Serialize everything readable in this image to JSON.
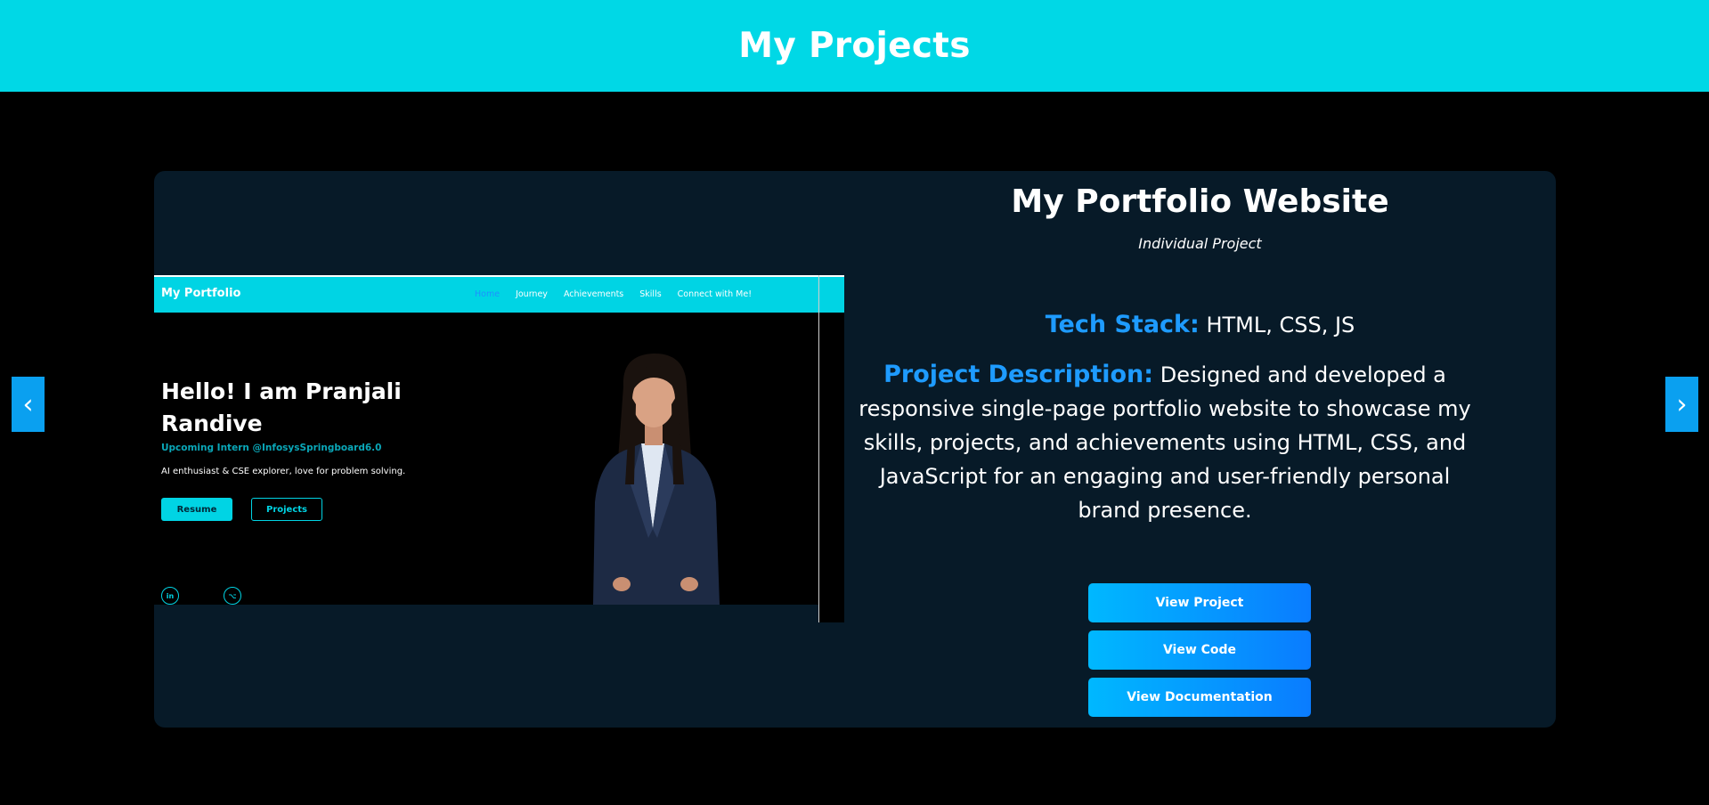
{
  "header": {
    "title": "My Projects"
  },
  "carousel": {
    "prev_glyph": "‹",
    "next_glyph": "›"
  },
  "project": {
    "title": "My Portfolio Website",
    "subtitle": "Individual Project",
    "tech_label": "Tech Stack:",
    "tech_value": "HTML, CSS, JS",
    "desc_label": "Project Description:",
    "desc_value": "Designed and developed a responsive single-page portfolio website to showcase my skills, projects, and achievements using HTML, CSS, and JavaScript for an engaging and user-friendly personal brand presence.",
    "buttons": {
      "view_project": "View Project",
      "view_code": "View Code",
      "view_docs": "View Documentation"
    }
  },
  "preview": {
    "brand": "My Portfolio",
    "nav": [
      "Home",
      "Journey",
      "Achievements",
      "Skills",
      "Connect with Me!"
    ],
    "hello": "Hello! I am Pranjali Randive",
    "intern": "Upcoming Intern @InfosysSpringboard6.0",
    "desc": "AI enthusiast & CSE explorer, love for problem solving.",
    "resume": "Resume",
    "projects": "Projects",
    "social_linkedin": "in",
    "social_github": "⌥"
  },
  "colors": {
    "accent": "#00d8e6",
    "label_blue": "#1e9bff",
    "card_bg": "#071a28",
    "button_gradient_start": "#00b8ff",
    "button_gradient_end": "#0a7cff"
  }
}
